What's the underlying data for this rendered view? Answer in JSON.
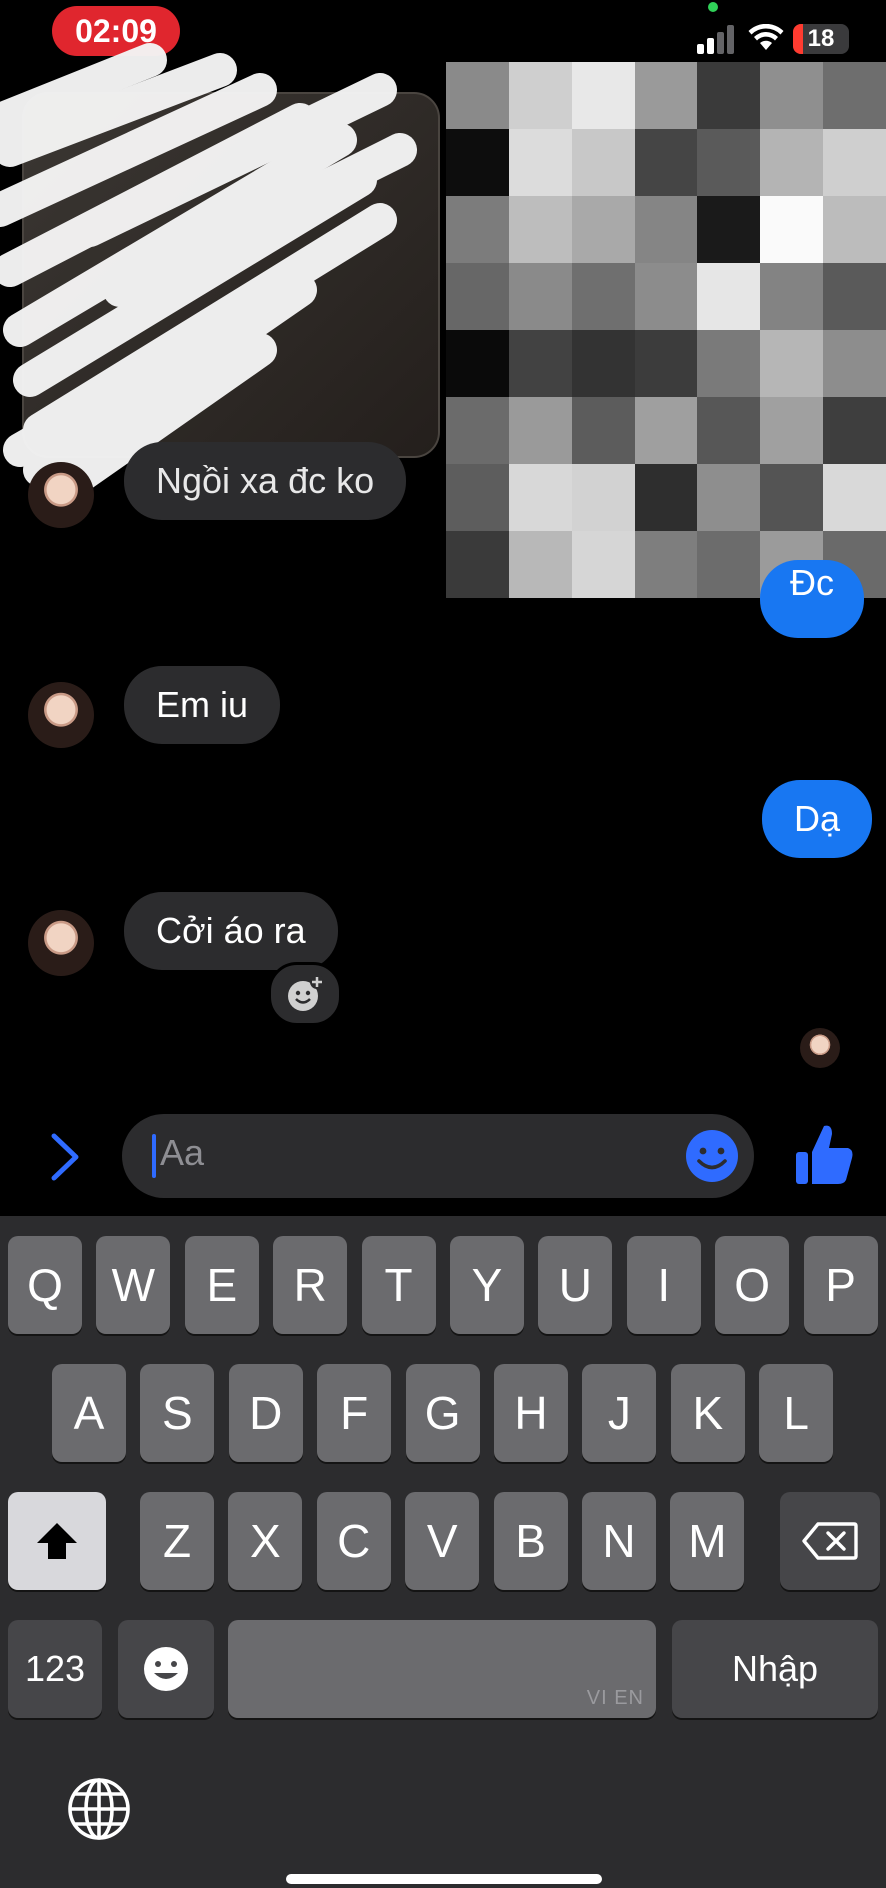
{
  "status_bar": {
    "time": "02:09",
    "battery": "18"
  },
  "colors": {
    "accent": "#1877f2",
    "recording": "#e0262e",
    "bubble_in": "#2c2c2e",
    "keyboard_bg": "#2c2c2e"
  },
  "messages": [
    {
      "side": "in",
      "text": "Ngồi xa đc ko"
    },
    {
      "side": "out",
      "text": "Đc"
    },
    {
      "side": "in",
      "text": "Em iu"
    },
    {
      "side": "out",
      "text": "Dạ"
    },
    {
      "side": "in",
      "text": "Cởi áo ra"
    }
  ],
  "composer": {
    "placeholder": "Aa"
  },
  "icons": [
    "chevron-right-icon",
    "smiley-icon",
    "thumbs-up-icon",
    "add-reaction-icon",
    "shift-icon",
    "backspace-icon",
    "emoji-icon",
    "globe-icon"
  ],
  "keyboard": {
    "row1": [
      "Q",
      "W",
      "E",
      "R",
      "T",
      "Y",
      "U",
      "I",
      "O",
      "P"
    ],
    "row2": [
      "A",
      "S",
      "D",
      "F",
      "G",
      "H",
      "J",
      "K",
      "L"
    ],
    "row3": [
      "Z",
      "X",
      "C",
      "V",
      "B",
      "N",
      "M"
    ],
    "numbers_label": "123",
    "return_label": "Nhập",
    "language_indicator": "VI EN"
  }
}
